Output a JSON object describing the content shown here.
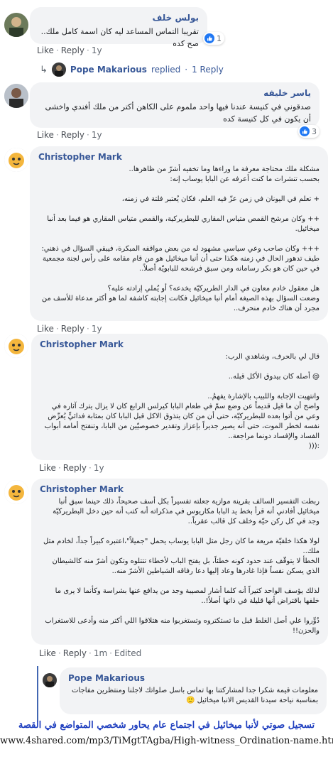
{
  "actions": {
    "like": "Like",
    "reply": "Reply"
  },
  "comments": [
    {
      "author": "بولس خلف",
      "text": "تقريبا التماس المساعد ليه كان اسمة كامل ملك.. صح كده",
      "time": "1y",
      "reactions": "1"
    },
    {
      "author": "ياسر خليفه",
      "text": "صدقوني في كنيسة عندنا فيها واحد ملموم على الكاهن أكتر من ملك أفندي واخشى أن يكون في كل كنيسة كده",
      "time": "1y",
      "reactions": "3"
    },
    {
      "author": "Christopher Mark",
      "text": "مشكلة ملك محتاجة معرفة ما وراءها وما تخفيه أشرّ من ظاهرها..\nبحسب تنشرات ما كنت أعرفه عن البابا يوساب إنه:\n\n+ تعلم في اليونان في زمن عزّ فيه العلم، فكان يُعتبر فلتة في زمنه،\n\n++ وكان مرشح القمص متياس المقاري للبطريركية، والقمص متياس المقاري هو فيما بعد أنبا ميخائيل.\n\n+++ وكان صاحب وعي سياسي مشهود له من بعض مواقفه المبكرة، فيبقي السؤال في ذهني:\nطيف تدهور الحال في زمنه هكذا حتى أن أنبا ميخائيل هو من قام مقامه على رأس لجنة مجمعية في حين كان هو بكر رسامانه ومن سبق فرشحه للبابويّة أصلاً..\n\nهل معقول خادم معاون في الدار الطريركيّة يخدعه؟ أو يُملي إرادته عليه؟\nوضعت السؤال بهذه الصيغة أمام أنبا ميخائيل فكانت إجابته كاشفة لما هو أكثر مدعاة للأسف من مجرد أن هناك خادم منحرف..",
      "time": "1y"
    },
    {
      "author": "Christopher Mark",
      "text": "قال لي بالحرف، وشاهدي الرب:\n\n@ أصله كان بيدوق الأكل قبله..\n\nوانتهيت الإجابة واللبيب بالإشارة يفهمُ..\nواضح أن ما قيل قديماً عن وضع سمّ في طعام البابا كيرلس الرابع كان لا يزال يترك آثاره في وعي من أتوا بعده للبطريركيّة، حتى أن من كان يتذوق الاكل قبل البابا كان بمثابة فدائيٍّ يُعرِّض نفسه لخطر الموت، حتى أنه يصير جديراً بإعزاز وتقدير خصوصيّين من البابا، وتنفتح أمامه أبواب الفساد والإفساد دونما مراجعة..\n:(((",
      "time": "1y"
    },
    {
      "author": "Christopher Mark",
      "text": "ربطت التفسير السالف بقرينة موازية جعلته تفسيراً بكل أسف صحيحاً، ذلك حينما سبق أنبا ميخائيل أفادني أنه قرأ بخط يد البابا مكاريوس في مذكراته أنه كتب أنه حين دخل البطريركيّة وجد في كل ركن حيّة وخلف كل قالب عقرباً..\n\nلولا هكذا خلفيّة مريعة ما كان رجل مثل البابا يوساب يحمل \"جميلاً\"،اعتبره كبيراً جداً، لخادم مثل ملك..\nالخطأ لا يتوقّف عند حدود كونه خطئاً، بل يفتح الباب لأخطاء تتتلوه وتكون أشرّ منه كالشيطان الذي يسكن نفساً فإذا غادرها وعاد إليها دعا رفاقه الشياطين الأشرّ منه..\n\nلذلك يؤسف الواحد كثيراً أنه كلما أشار لمصيبة وجد من يدافع عنها بشراسة وكأنما لا يرى ما خلفها باقتراض أنها قليلة في ذاتها أصلاً!..\n\nدُوِّروا علي أصل الغلط قبل ما تستكتروه وتستغربوا منه هتلاقوا اللي أكتر منه وأدعى للاستغراب والحزن!!",
      "time": "1m",
      "edited": "Edited"
    }
  ],
  "replied_summary": {
    "name": "Pope Makarious",
    "verb": "replied",
    "count": "1 Reply"
  },
  "reply": {
    "author": "Pope Makarious",
    "text": "معلومات قيمة شكرا جدا لمشاركتنا بها تماس باسل صلواتك لاجلنا ومنتظرين مفاجات بمناسبة نياحة سيدنا القديس الانبا ميخائيل 🙂",
    "time": "1y"
  },
  "banner": {
    "title": "تسجيل صوتي لأنبا ميخائيل في اجتماع عام يحاور شخصي المتواضع في القصة",
    "url": "www.4shared.com/mp3/TiMgtTAgba/High-witness_Ordination-name.html"
  },
  "colors": {
    "link": "#385898",
    "like_blue": "#2078f4",
    "bubble": "#f2f3f5",
    "banner_title": "#1f3fbf"
  }
}
